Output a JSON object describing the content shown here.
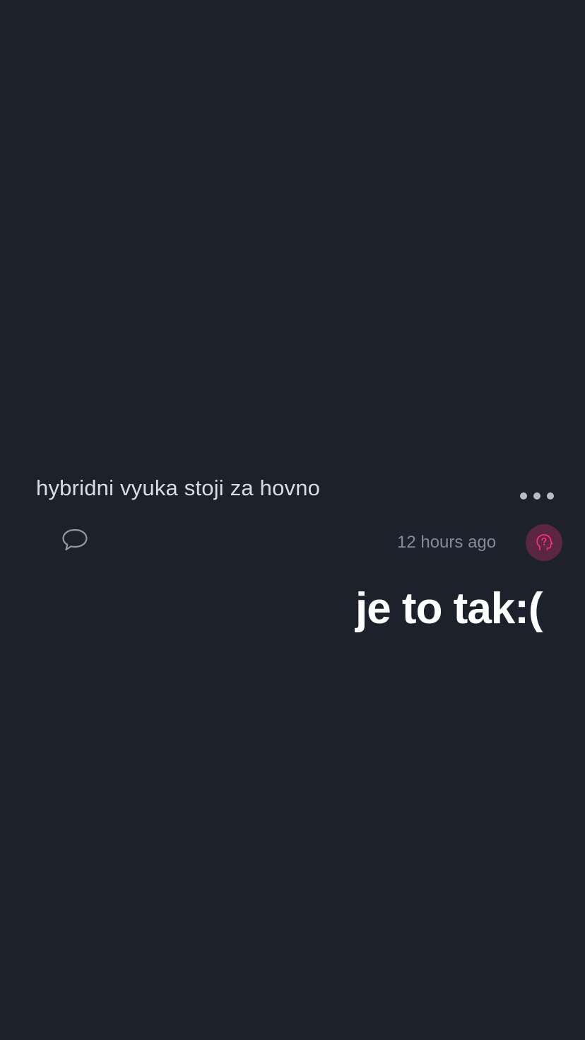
{
  "post": {
    "text": "hybridni vyuka stoji za hovno",
    "timestamp": "12 hours ago",
    "avatar_icon": "head-question-icon",
    "more_icon": "more-options-icon",
    "comment_icon": "comment-bubble-icon"
  },
  "overlay": {
    "caption": "je to tak:("
  },
  "colors": {
    "background": "#1c212c",
    "accent": "#ff2d78",
    "avatar_bg": "#5b2740"
  }
}
